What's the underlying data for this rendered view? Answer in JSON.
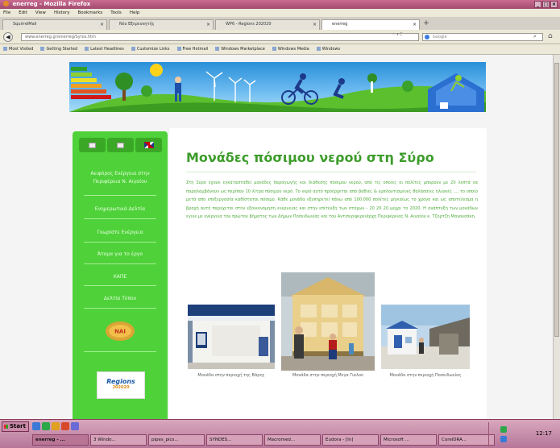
{
  "window": {
    "title": "enerreg - Mozilla Firefox"
  },
  "menu": [
    "File",
    "Edit",
    "View",
    "History",
    "Bookmarks",
    "Tools",
    "Help"
  ],
  "tabs": [
    {
      "label": "SquirrelMail",
      "active": false
    },
    {
      "label": "Νέο Εξερευνητής",
      "active": false
    },
    {
      "label": "WP6 - Regions 202020",
      "active": false
    },
    {
      "label": "enerreg",
      "active": true
    }
  ],
  "address": {
    "url": "www.enerreg.gr/enerreg/Syros.htm",
    "search_placeholder": "Google"
  },
  "bookmarks": [
    "Most Visited",
    "Getting Started",
    "Latest Headlines",
    "Customize Links",
    "Free Hotmail",
    "Windows Marketplace",
    "Windows Media",
    "Windows"
  ],
  "sidebar": {
    "flags": [
      "greek-flag-1",
      "greek-flag-2",
      "uk-flag"
    ],
    "items": [
      {
        "label": "Αειφόρος Ενέργεια στην Περιφέρεια Ν. Αιγαίου"
      },
      {
        "label": "Ενημερωτικά Δελτία"
      },
      {
        "label": "Γνωρίστε Ενέργεια"
      },
      {
        "label": "Άτομα για το έργο"
      },
      {
        "label": "ΚΑΠΕ"
      },
      {
        "label": "Δελτία Τύπου"
      }
    ],
    "badge": "ΝΑΙ",
    "regions_logo": {
      "name": "Regions",
      "year": "202020"
    }
  },
  "content": {
    "title": "Μονάδες πόσιμου νερού στη Σύρο",
    "body": "Στη Σύρο έχουν εγκατασταθεί μονάδες παραγωγής και διάθεσης πόσιμου νερού, από τις οποίες οι πολίτες μπορούν με 20 λεπτά να παραλαμβάνουν ως περίπου 10 λίτρα πόσιμου νερό. Το νερό αυτό προέρχεται από βαθιές & εμπλουτισμένες θαλάσσιες ηλιακές ..., το οποίο μετά από επεξεργασία καθίσταται πόσιμο. Κάθε μονάδα εξυπηρετεί πάνω από 100.000 πολίτες μηνιαίως το χρόνο και ως αποτέλεσμα η βροχή αυτή παρέχεται στην εξοικονόμηση ενέργειας και στην επίτευξη των στόχων - 20 20 20 μέχρι το 2020. Η ανάπτυξη των μονάδων έγινε με ενέργεια του πρώτου βήματος των Δήμων Ποσειδωνίας και του Αντιπεριφερειάρχη Περιφέρειας Ν. Αιγαίου κ. Τζόρτζη Μανουσάκη.",
    "photos": [
      {
        "caption": "Μονάδα στην περιοχή της Βάρης"
      },
      {
        "caption": "Μονάδα στην περιοχή Μεγα Γιαλού"
      },
      {
        "caption": "Μονάδα στην περιοχή Ποσειδωνίας"
      }
    ]
  },
  "taskbar": {
    "start_label": "Start",
    "tasks": [
      {
        "label": "enerreg - ...",
        "active": true
      },
      {
        "label": "3 Windo...",
        "active": false
      },
      {
        "label": "pipes_pics...",
        "active": false
      },
      {
        "label": "SYNDES...",
        "active": false
      },
      {
        "label": "Macromed...",
        "active": false
      },
      {
        "label": "Eudora - [In]",
        "active": false
      },
      {
        "label": "Microsoft ...",
        "active": false
      },
      {
        "label": "CorelDRA...",
        "active": false
      }
    ],
    "clock": "12:17"
  },
  "colors": {
    "sidebar_green": "#4fd13a",
    "title_green": "#3c9c2a",
    "taskbar_pink": "#b6769a"
  }
}
